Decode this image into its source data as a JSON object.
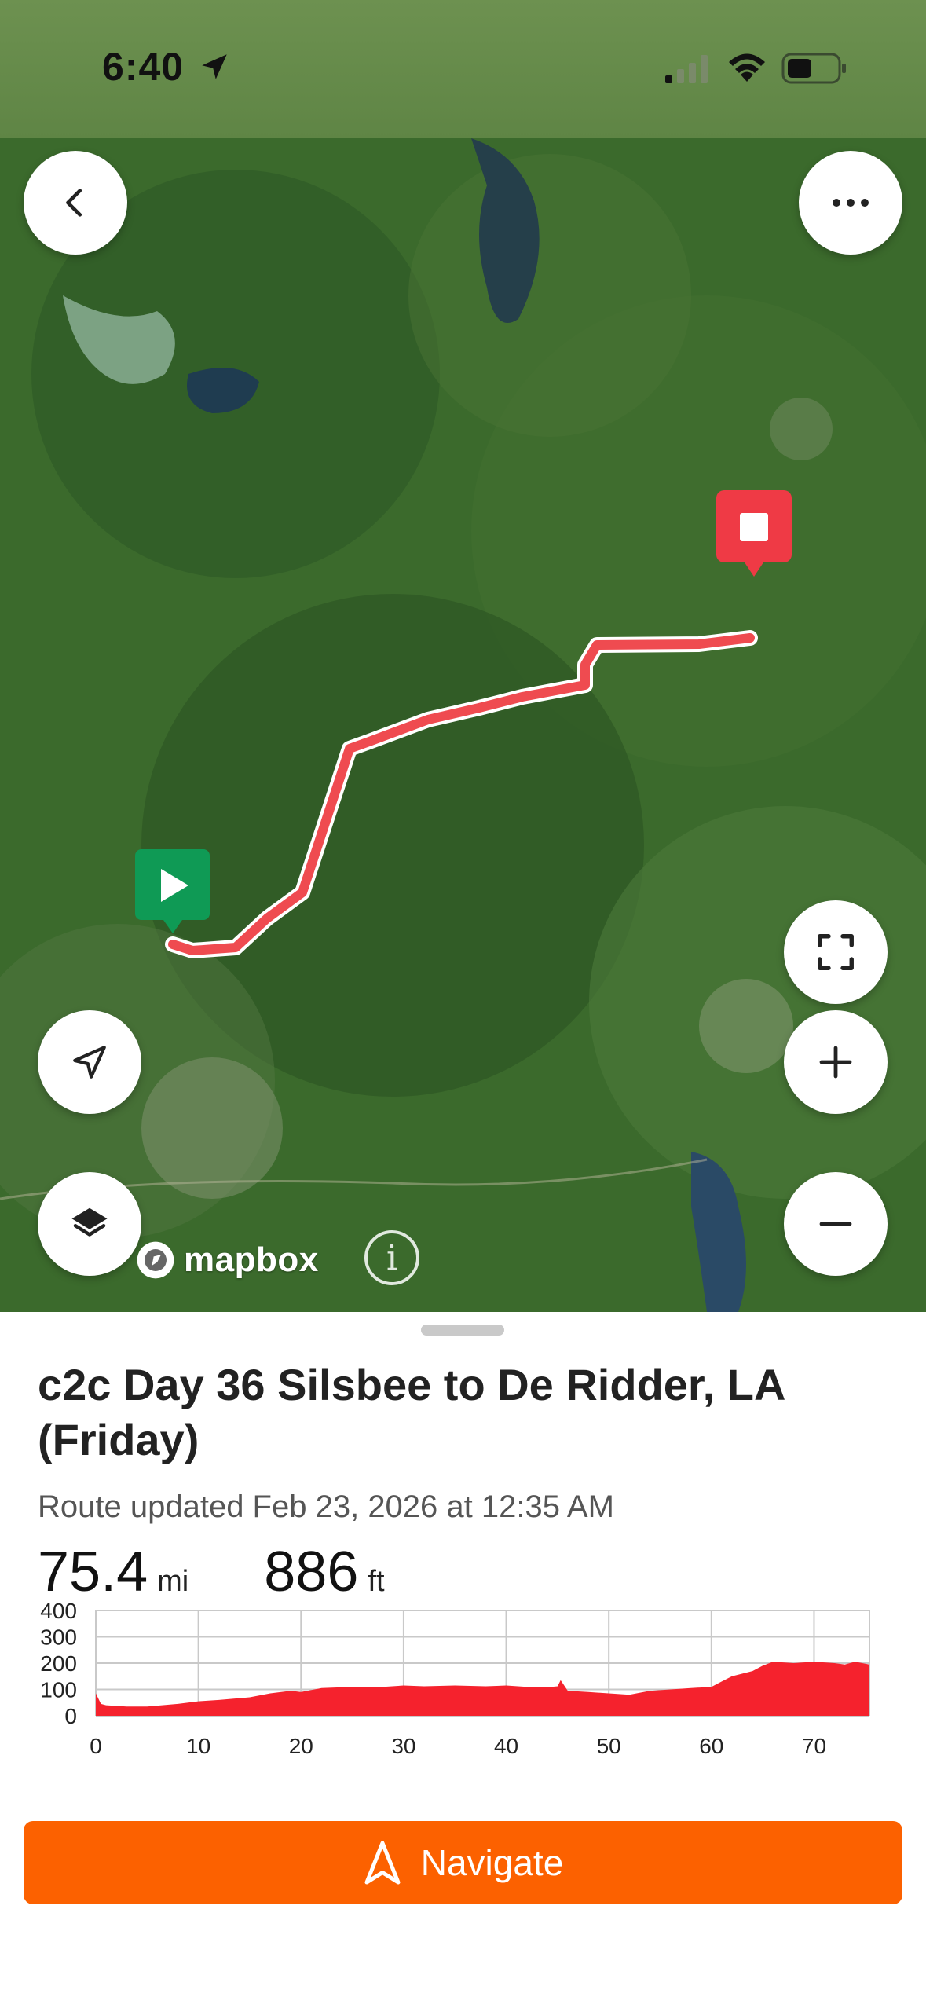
{
  "status_bar": {
    "time": "6:40",
    "icons": [
      "location-arrow-icon",
      "cellular-signal-icon",
      "wifi-icon",
      "battery-icon"
    ]
  },
  "map": {
    "provider_logo": "mapbox",
    "controls": [
      "back-icon",
      "more-icon",
      "fullscreen-icon",
      "locate-icon",
      "zoom-in-icon",
      "layers-icon",
      "zoom-out-icon",
      "info-icon"
    ],
    "colors": {
      "route": "#ef4b50",
      "start_marker": "#0f9a55",
      "end_marker": "#ef3a45"
    }
  },
  "route": {
    "title": "c2c Day 36 Silsbee to De Ridder, LA (Friday)",
    "updated": "Route updated Feb 23, 2026 at 12:35 AM",
    "distance_value": "75.4",
    "distance_unit": "mi",
    "elevation_value": "886",
    "elevation_unit": "ft"
  },
  "chart_data": {
    "type": "area",
    "xlabel": "",
    "ylabel": "",
    "xlim": [
      0,
      75.4
    ],
    "ylim": [
      0,
      400
    ],
    "x_ticks": [
      0,
      10,
      20,
      30,
      40,
      50,
      60,
      70
    ],
    "y_ticks": [
      0,
      100,
      200,
      300,
      400
    ],
    "grid": true,
    "color": "#f5222d",
    "x": [
      0,
      0.5,
      1,
      3,
      5,
      8,
      10,
      12,
      15,
      17,
      19,
      20,
      22,
      25,
      28,
      30,
      32,
      35,
      38,
      40,
      42,
      44,
      45,
      45.3,
      46,
      48,
      50,
      52,
      54,
      56,
      58,
      60,
      61,
      62,
      64,
      65,
      66,
      68,
      70,
      72,
      73,
      74,
      75.4
    ],
    "y": [
      85,
      45,
      40,
      35,
      35,
      45,
      55,
      60,
      70,
      85,
      95,
      90,
      105,
      110,
      110,
      115,
      112,
      115,
      112,
      115,
      110,
      108,
      112,
      135,
      95,
      90,
      85,
      80,
      95,
      100,
      105,
      110,
      130,
      150,
      170,
      190,
      205,
      200,
      205,
      200,
      195,
      205,
      195
    ]
  },
  "navigate_button": {
    "label": "Navigate",
    "icon": "navigation-arrow-icon"
  }
}
